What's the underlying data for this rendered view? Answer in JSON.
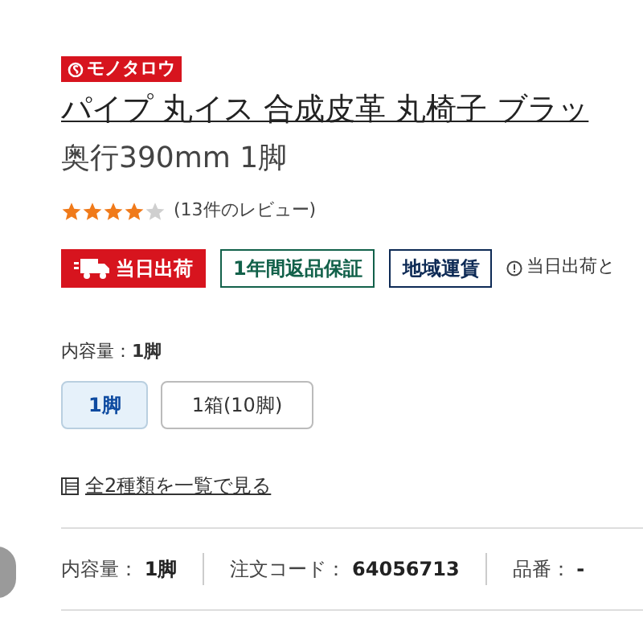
{
  "logo": {
    "text": "モノタロウ"
  },
  "title": {
    "line_1": "パイプ 丸イス 合成皮革 丸椅子 ブラッ",
    "line_2": "奥行390mm 1脚"
  },
  "rating": {
    "stars": 4,
    "reviews": "(13件のレビュー)"
  },
  "badges": [
    {
      "kind": "shipping",
      "text": "当日出荷"
    },
    {
      "kind": "guarantee",
      "text": "1年間返品保証"
    },
    {
      "kind": "regional",
      "text": "地域運賃"
    }
  ],
  "shipping_note": "当日出荷と",
  "variant": {
    "label": "内容量：",
    "value": "1脚",
    "options": [
      {
        "text": "1脚",
        "selected": true
      },
      {
        "text": "1箱(10脚)",
        "selected": false
      }
    ]
  },
  "list_link": "全2種類を一覧で見る",
  "specs": [
    {
      "label": "内容量：",
      "value": "1脚"
    },
    {
      "label": "注文コード：",
      "value": "64056713"
    },
    {
      "label": "品番：",
      "value": "-"
    }
  ]
}
